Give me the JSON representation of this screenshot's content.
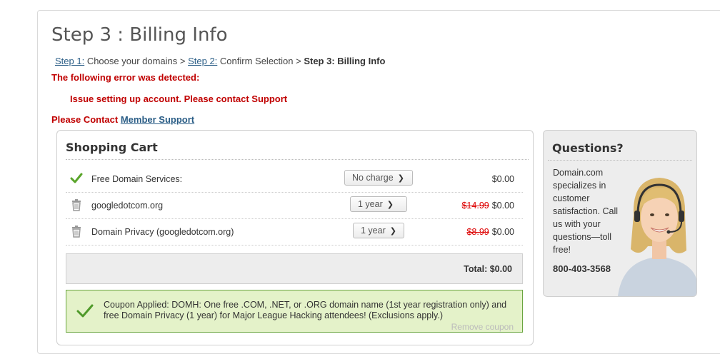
{
  "page": {
    "title": "Step 3 : Billing Info",
    "breadcrumb": {
      "step1_link": "Step 1:",
      "step1_text": " Choose your domains > ",
      "step2_link": "Step 2:",
      "step2_text": " Confirm Selection > ",
      "step3": "Step 3: Billing Info"
    },
    "error_heading": "The following error was detected:",
    "error_message": "Issue setting up account. Please contact Support",
    "contact_prefix": "Please Contact ",
    "contact_link": "Member Support"
  },
  "cart": {
    "title": "Shopping Cart",
    "items": [
      {
        "icon": "check-icon",
        "name": "Free Domain Services:",
        "term": "No charge",
        "old_price": "",
        "price": "$0.00"
      },
      {
        "icon": "trash-icon",
        "name": "googledotcom.org",
        "term": "1 year",
        "old_price": "$14.99",
        "price": "$0.00"
      },
      {
        "icon": "trash-icon",
        "name": "Domain Privacy (googledotcom.org)",
        "term": "1 year",
        "old_price": "$8.99",
        "price": "$0.00"
      }
    ],
    "total": "Total: $0.00",
    "coupon": {
      "text": "Coupon Applied: DOMH: One free .COM, .NET, or .ORG domain name (1st year registration only) and free Domain Privacy (1 year) for Major League Hacking attendees! (Exclusions apply.)",
      "remove_label": "Remove coupon"
    }
  },
  "questions": {
    "title": "Questions?",
    "body": "Domain.com specializes in customer satisfaction. Call us with your questions—toll free!",
    "phone": "800-403-3568"
  },
  "colors": {
    "error_red": "#c00000",
    "link_blue": "#2a5d86",
    "coupon_bg": "#e4f2c9",
    "coupon_border": "#6aa540"
  }
}
